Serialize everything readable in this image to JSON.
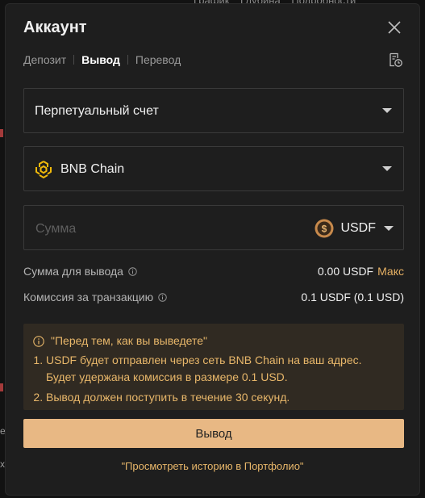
{
  "background": {
    "top_tabs": [
      "График",
      "Глубина",
      "Подробности"
    ],
    "left_chars": [
      "е",
      "х"
    ]
  },
  "modal": {
    "title": "Аккаунт",
    "tabs": [
      {
        "label": "Депозит",
        "active": false
      },
      {
        "label": "Вывод",
        "active": true
      },
      {
        "label": "Перевод",
        "active": false
      }
    ],
    "account_select": {
      "value": "Перпетуальный счет"
    },
    "network_select": {
      "value": "BNB Chain",
      "icon": "bnb-chain-icon"
    },
    "amount": {
      "placeholder": "Сумма",
      "value": "",
      "token": "USDF",
      "token_icon": "usdf-token-icon"
    },
    "withdraw_amount": {
      "label": "Сумма для вывода",
      "value": "0.00 USDF",
      "max_label": "Макс"
    },
    "fee": {
      "label": "Комиссия за транзакцию",
      "value": "0.1 USDF (0.1 USD)"
    },
    "notice": {
      "title": "\"Перед тем, как вы выведете\"",
      "items": [
        "USDF будет отправлен через сеть BNB Chain на ваш адрес. Будет удержана комиссия в размере 0.1 USD.",
        "Вывод должен поступить в течение 30 секунд."
      ]
    },
    "submit_label": "Вывод",
    "portfolio_link": "\"Просмотреть историю в Портфолио\""
  },
  "colors": {
    "accent": "#e8b884",
    "notice_bg": "#302a22",
    "notice_text": "#e8b76a",
    "modal_bg": "#1e1e1e"
  }
}
